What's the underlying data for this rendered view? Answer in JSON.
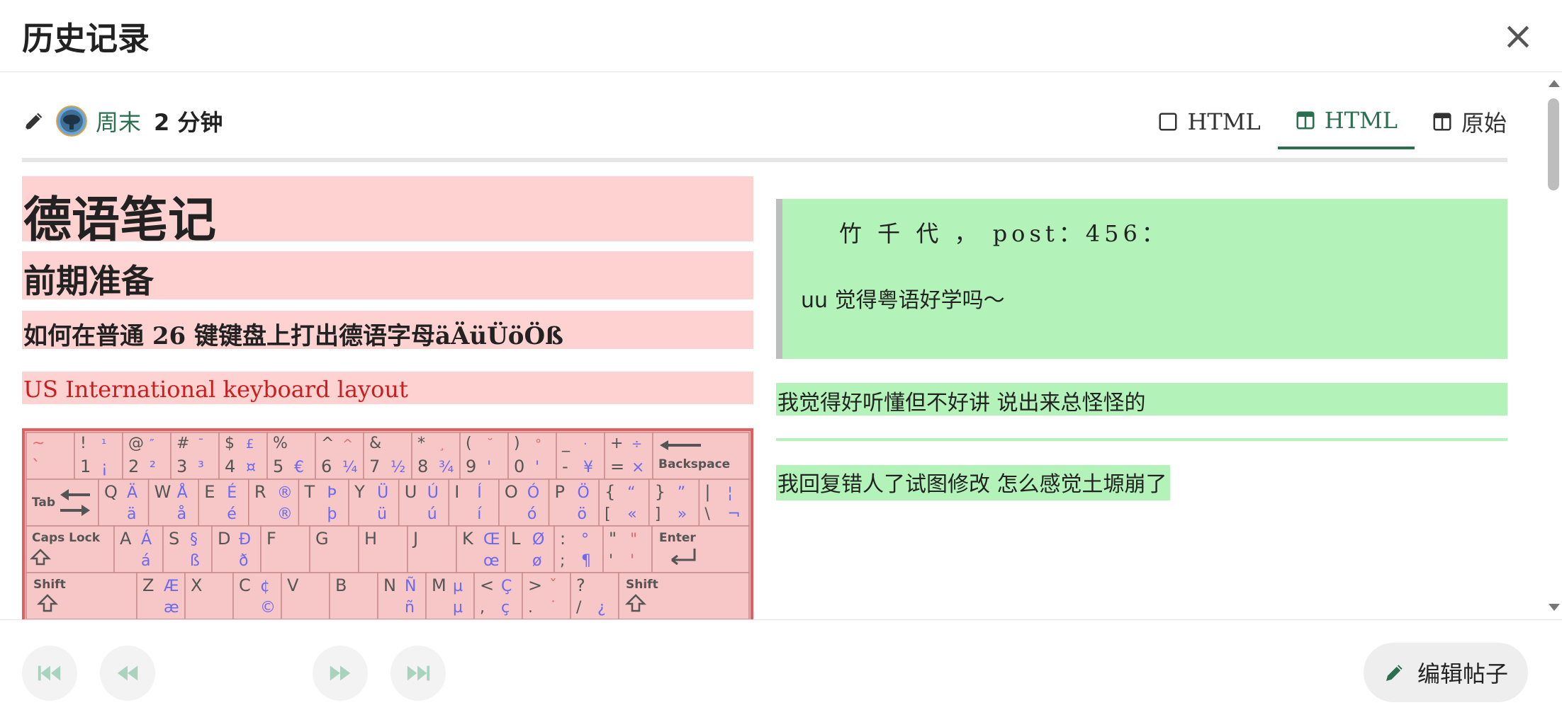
{
  "modal": {
    "title": "历史记录",
    "close_label": "×"
  },
  "meta": {
    "username": "周末",
    "revision": "2 分钟"
  },
  "tabs": [
    {
      "label": "HTML",
      "icon": "square-icon"
    },
    {
      "label": "HTML",
      "icon": "columns-icon",
      "active": true
    },
    {
      "label": "原始",
      "icon": "columns-icon"
    }
  ],
  "left": {
    "h1": "德语笔记",
    "h2": "前期准备",
    "h3_prefix": "如何在普通",
    "h3_num": "26",
    "h3_mid": "键键盘上打出德语字母",
    "h3_letters": "äÄüÜöÖß",
    "link": "US International keyboard layout",
    "keyboard": {
      "row1": [
        [
          "~",
          "`"
        ],
        [
          "!",
          "1"
        ],
        [
          "@",
          "2"
        ],
        [
          "#",
          "3"
        ],
        [
          "$",
          "4"
        ],
        [
          "%",
          "5"
        ],
        [
          "^",
          "6"
        ],
        [
          "&",
          "7"
        ],
        [
          "*",
          "8"
        ],
        [
          "(",
          "9"
        ],
        [
          ")",
          "0"
        ],
        [
          "_",
          "-"
        ],
        [
          "+",
          "="
        ]
      ],
      "row1_alt": [
        [
          "",
          ""
        ],
        [
          "¹",
          "¡"
        ],
        [
          "″",
          "²"
        ],
        [
          "¯",
          "³"
        ],
        [
          "£",
          "¤"
        ],
        [
          "",
          "€"
        ],
        [
          "^",
          "¼"
        ],
        [
          "",
          "½"
        ],
        [
          "¸",
          "¾"
        ],
        [
          "˘",
          "'"
        ],
        [
          "°",
          "'"
        ],
        [
          "·",
          "¥"
        ],
        [
          "÷",
          "×"
        ]
      ],
      "backspace": "Backspace",
      "tab": "Tab",
      "row2": [
        "Q",
        "W",
        "E",
        "R",
        "T",
        "Y",
        "U",
        "I",
        "O",
        "P",
        "{",
        "}",
        "|"
      ],
      "row2_alt": [
        [
          "Ä",
          "ä"
        ],
        [
          "Å",
          "å"
        ],
        [
          "É",
          "é"
        ],
        [
          "®",
          "®"
        ],
        [
          "Þ",
          "þ"
        ],
        [
          "Ü",
          "ü"
        ],
        [
          "Ú",
          "ú"
        ],
        [
          "Í",
          "í"
        ],
        [
          "Ó",
          "ó"
        ],
        [
          "Ö",
          "ö"
        ],
        [
          "“",
          "«"
        ],
        [
          "”",
          "»"
        ],
        [
          "¦",
          "¬"
        ]
      ],
      "row2_low": [
        "",
        "",
        "",
        "",
        "",
        "",
        "",
        "",
        "",
        "",
        "[",
        "]",
        "\\"
      ],
      "capslock": "Caps Lock",
      "row3": [
        "A",
        "S",
        "D",
        "F",
        "G",
        "H",
        "J",
        "K",
        "L",
        ":",
        "\""
      ],
      "row3_alt": [
        [
          "Á",
          "á"
        ],
        [
          "§",
          "ß"
        ],
        [
          "Đ",
          "ð"
        ],
        [
          "",
          ""
        ],
        [
          "",
          ""
        ],
        [
          "",
          ""
        ],
        [
          "",
          ""
        ],
        [
          "Œ",
          "œ"
        ],
        [
          "Ø",
          "ø"
        ],
        [
          "°",
          "¶"
        ],
        [
          "\"",
          "'"
        ]
      ],
      "row3_low": [
        "",
        "",
        "",
        "",
        "",
        "",
        "",
        "",
        "",
        ";",
        "'"
      ],
      "enter": "Enter",
      "shift": "Shift",
      "row4": [
        "Z",
        "X",
        "C",
        "V",
        "B",
        "N",
        "M",
        "<",
        ">",
        "?"
      ],
      "row4_alt": [
        [
          "Æ",
          "æ"
        ],
        [
          "",
          ""
        ],
        [
          "¢",
          "©"
        ],
        [
          "",
          ""
        ],
        [
          "",
          ""
        ],
        [
          "Ñ",
          "ñ"
        ],
        [
          "µ",
          "µ"
        ],
        [
          "Ç",
          "ç"
        ],
        [
          "ˇ",
          "˙"
        ],
        [
          "",
          "¿"
        ]
      ],
      "row4_low": [
        "",
        "",
        "",
        "",
        "",
        "",
        "",
        ",",
        ".",
        "/"
      ]
    }
  },
  "right": {
    "quote_line1": "竹 千 代 ， post：456：",
    "quote_line2": "uu 觉得粤语好学吗～",
    "para1": "我觉得好听懂但不好讲 说出来总怪怪的",
    "para2": "我回复错人了试图修改 怎么感觉土塬崩了"
  },
  "footer": {
    "edit_label": "编辑帖子"
  },
  "colors": {
    "accent": "#2a6f50",
    "deleted": "#ffd2d2",
    "inserted": "#b3f3b9",
    "link_red": "#c81e1e"
  }
}
